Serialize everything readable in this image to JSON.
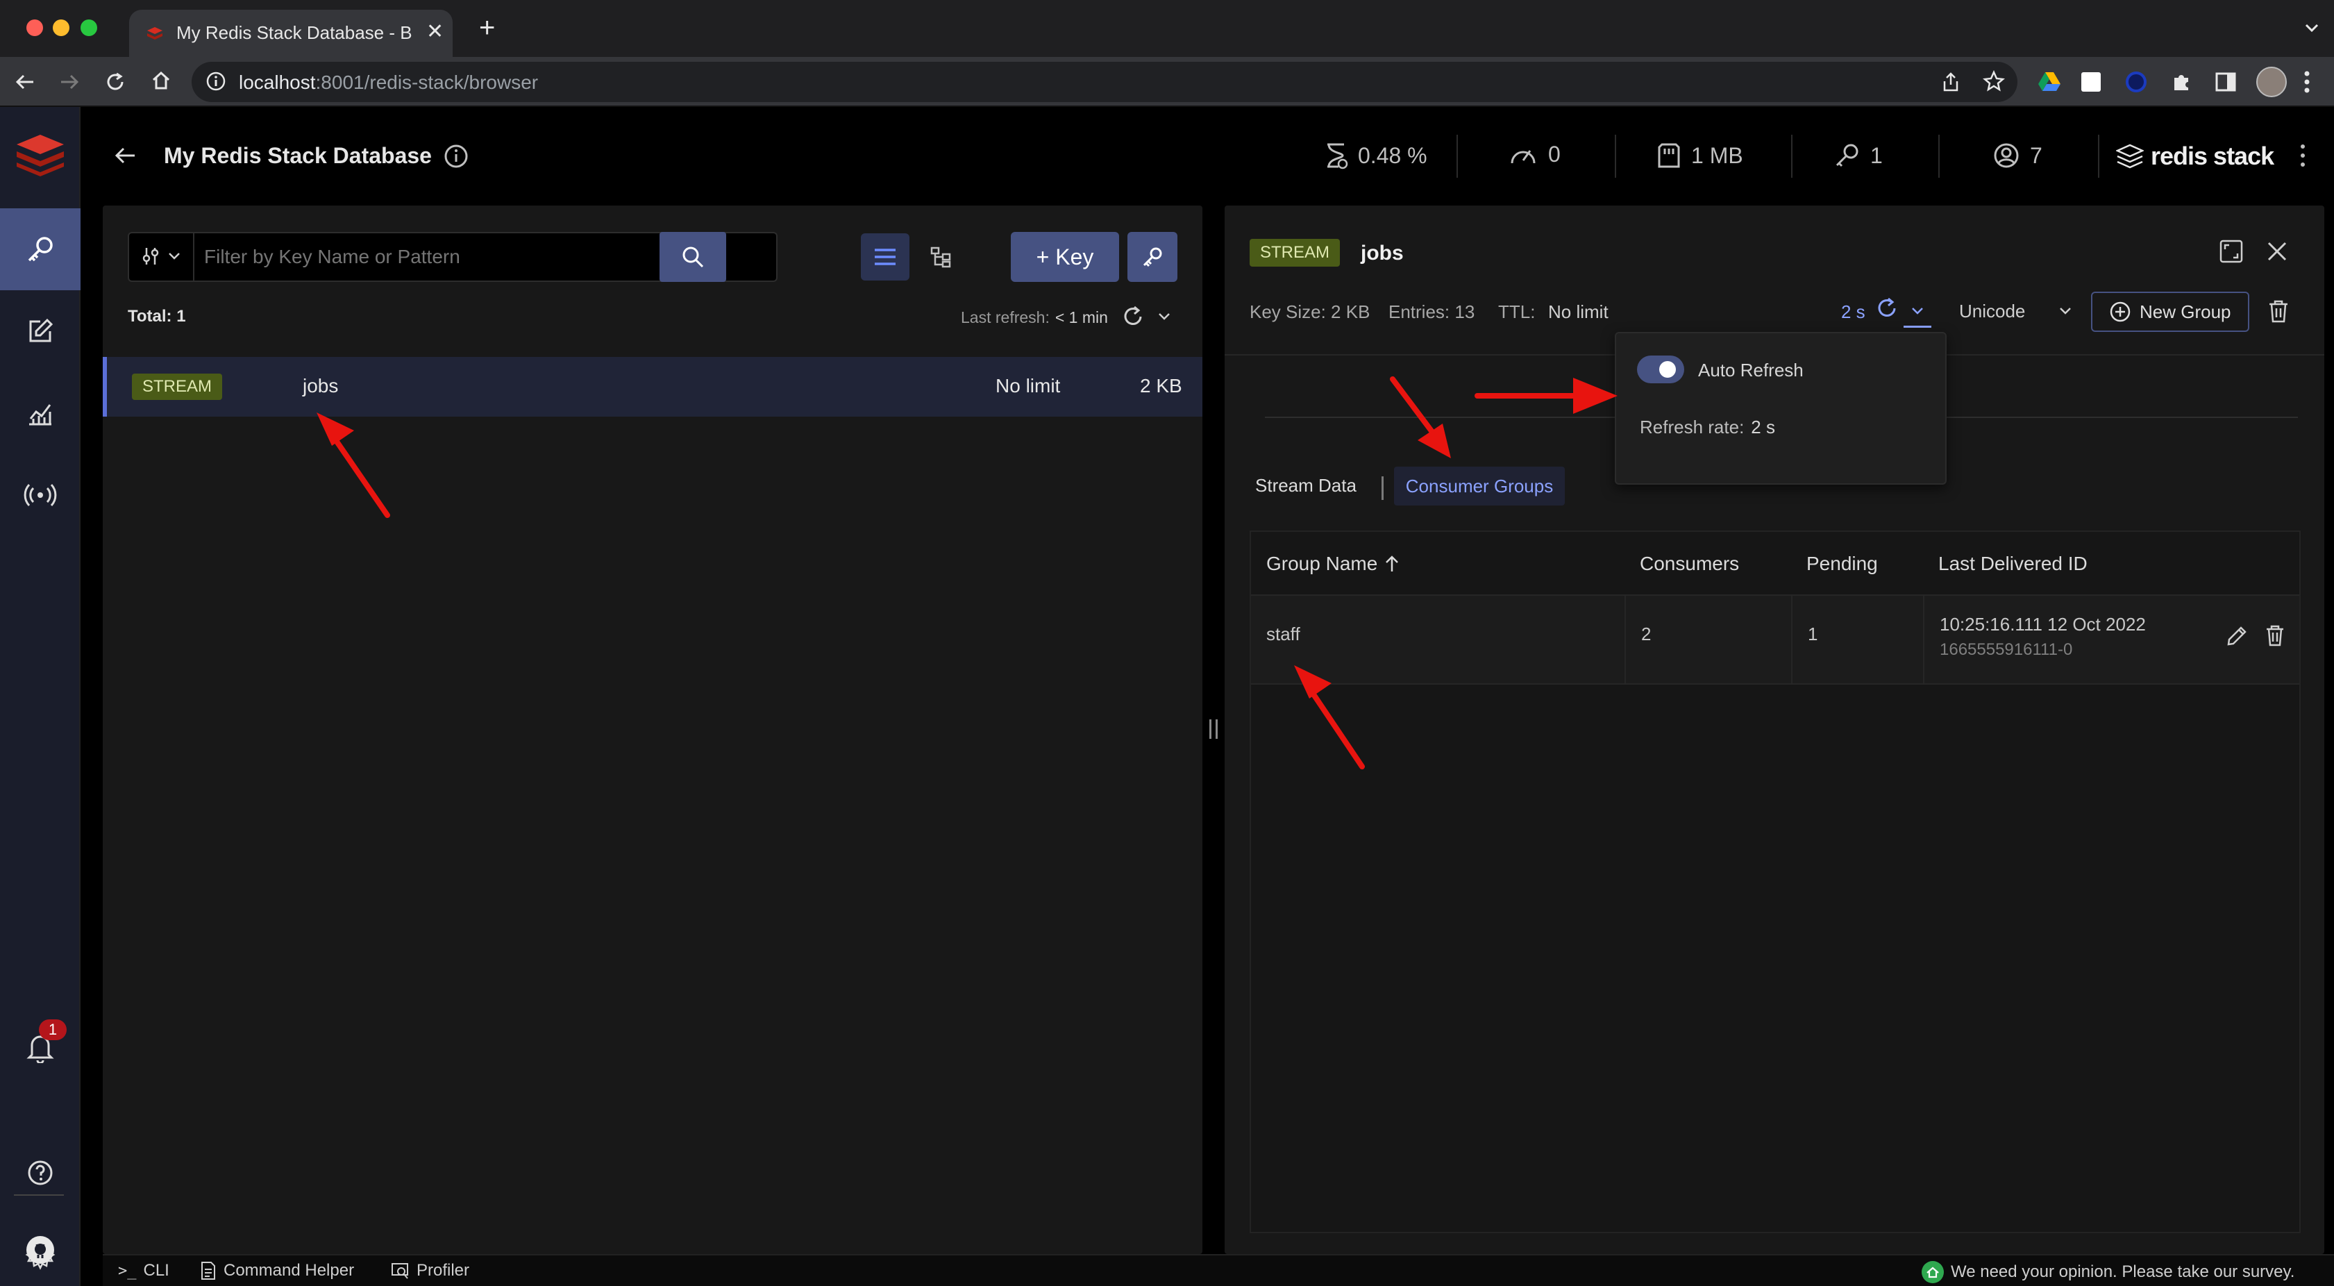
{
  "browser": {
    "tab_title": "My Redis Stack Database - Bro",
    "new_tab_label": "+",
    "url_host": "localhost",
    "url_path": ":8001/redis-stack/browser"
  },
  "header": {
    "title": "My Redis Stack Database",
    "cpu": "0.48 %",
    "ops": "0",
    "memory": "1 MB",
    "keys": "1",
    "clients": "7",
    "brand": "redis stack"
  },
  "sidebar": {
    "notification_count": "1"
  },
  "browser_panel": {
    "filter_placeholder": "Filter by Key Name or Pattern",
    "add_key_label": "+ Key",
    "total": "Total: 1",
    "last_refresh_label": "Last refresh:",
    "last_refresh_value": "< 1 min",
    "rows": [
      {
        "type": "STREAM",
        "name": "jobs",
        "ttl": "No limit",
        "size": "2 KB"
      }
    ]
  },
  "details": {
    "type": "STREAM",
    "key_name": "jobs",
    "key_size": "Key Size: 2 KB",
    "entries": "Entries: 13",
    "ttl_label": "TTL:",
    "ttl_value": "No limit",
    "refresh_rate_short": "2 s",
    "format": "Unicode",
    "new_group_label": "New Group",
    "popover": {
      "auto_refresh_label": "Auto Refresh",
      "refresh_rate_label": "Refresh rate:",
      "refresh_rate_value": "2 s"
    },
    "tabs": [
      "Stream Data",
      "Consumer Groups"
    ],
    "active_tab": "Consumer Groups",
    "table": {
      "columns": [
        "Group Name",
        "Consumers",
        "Pending",
        "Last Delivered ID"
      ],
      "rows": [
        {
          "name": "staff",
          "consumers": "2",
          "pending": "1",
          "last_delivered_time": "10:25:16.111 12 Oct 2022",
          "last_delivered_id": "1665555916111-0"
        }
      ]
    }
  },
  "statusbar": {
    "cli": "CLI",
    "command_helper": "Command Helper",
    "profiler": "Profiler",
    "survey": "We need your opinion. Please take our survey."
  },
  "colors": {
    "accent": "#465282",
    "stream_badge": "#4a5b17",
    "annotation_arrow": "#e8140f",
    "link_blue": "#8ba2ff"
  }
}
